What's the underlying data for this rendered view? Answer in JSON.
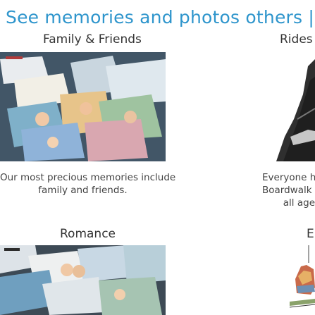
{
  "headline": "See memories and photos others |",
  "cards": [
    {
      "title": "Family & Friends",
      "photo_icon": "family-scrapbook-photo",
      "description_lines": [
        "Our most precious memories include",
        "family and friends."
      ]
    },
    {
      "title": "Rides",
      "photo_icon": "ride-photo",
      "description_lines": [
        "Everyone h",
        "Boardwalk h",
        "all age"
      ]
    },
    {
      "title": "Romance",
      "photo_icon": "romance-scrapbook-photo",
      "description_lines": []
    },
    {
      "title": "E",
      "photo_icon": "event-photo",
      "description_lines": []
    }
  ],
  "colors": {
    "headline": "#2e95cc",
    "text": "#333333"
  }
}
